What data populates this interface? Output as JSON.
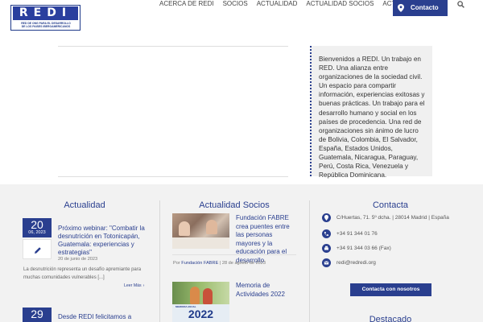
{
  "logo": {
    "text": "REDI",
    "line1": "RED DE ONG PARA EL DESARROLLO",
    "line2": "DE LOS PAISES IBEROAMERICANOS"
  },
  "nav": {
    "items": [
      {
        "label": "ACERCA DE REDI"
      },
      {
        "label": "SOCIOS"
      },
      {
        "label": "ACTUALIDAD"
      },
      {
        "label": "ACTUALIDAD SOCIOS"
      },
      {
        "label": "ACTIVIDADES"
      }
    ],
    "contact_label": "Contacto",
    "brand_color": "#2a3f8f"
  },
  "welcome": {
    "text": "Bienvenidos a  REDI. Un trabajo en RED. Una alianza entre organizaciones de la sociedad civil. Un espacio para compartir información, experiencias exitosas y buenas prácticas. Un trabajo para el desarrollo humano y social en los países de procedencia. Una red de organizaciones sin ánimo de lucro de Bolivia, Colombia, El Salvador, España, Estados Unidos, Guatemala, Nicaragua, Paraguay, Perú, Costa Rica, Venezuela y República Dominicana."
  },
  "footer": {
    "actualidad": {
      "title": "Actualidad",
      "post1": {
        "day": "20",
        "month_year": "06, 2023",
        "title": "Próximo webinar: \"Combatir la desnutrición en Totonicapán, Guatemala: experiencias y estrategias\"",
        "date": "20 de junio de 2023",
        "excerpt": "La desnutrición representa un desafío apremiante para muchas comunidades vulnerables [...]",
        "read_more": "Leer Más"
      },
      "post2": {
        "day": "29",
        "month_year": "",
        "title": "Desde REDI felicitamos a"
      }
    },
    "socios": {
      "title": "Actualidad Socios",
      "post1": {
        "title": "Fundación FABRE crea puentes entre las personas mayores y la educación para el desarrollo",
        "by": "Por",
        "author": "Fundación FABRE",
        "date": "28 de agosto de 2023"
      },
      "post2": {
        "title": "Memoria de Actividades 2022",
        "img_small": "MEMORIA ANUAL",
        "img_year": "2022"
      }
    },
    "contacta": {
      "title": "Contacta",
      "address": "C/Huertas, 71. 5º dcha. | 28014 Madrid | España",
      "phone": "+34 91 344 01 76",
      "fax": "+34 91 344 03 66 (Fax)",
      "email": "redi@redredi.org",
      "button": "Contacta con nosotros"
    },
    "destacado": {
      "title": "Destacado"
    }
  }
}
